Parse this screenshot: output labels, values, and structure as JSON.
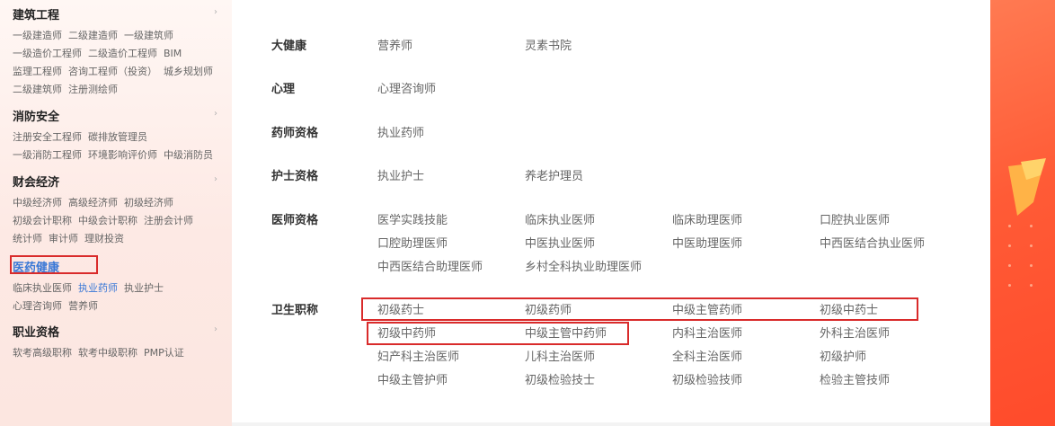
{
  "sidebar": {
    "categories": [
      {
        "title": "建筑工程",
        "rows": [
          [
            "一级建造师",
            "二级建造师",
            "一级建筑师"
          ],
          [
            "一级造价工程师",
            "二级造价工程师",
            "BIM"
          ],
          [
            "监理工程师",
            "咨询工程师（投资）",
            "城乡规划师"
          ],
          [
            "二级建筑师",
            "注册测绘师"
          ]
        ]
      },
      {
        "title": "消防安全",
        "rows": [
          [
            "注册安全工程师",
            "碳排放管理员"
          ],
          [
            "一级消防工程师",
            "环境影响评价师",
            "中级消防员"
          ]
        ]
      },
      {
        "title": "财会经济",
        "rows": [
          [
            "中级经济师",
            "高级经济师",
            "初级经济师"
          ],
          [
            "初级会计职称",
            "中级会计职称",
            "注册会计师"
          ],
          [
            "统计师",
            "审计师",
            "理财投资"
          ]
        ]
      },
      {
        "title": "医药健康",
        "rows": [
          [
            "临床执业医师",
            "执业药师",
            "执业护士"
          ],
          [
            "心理咨询师",
            "营养师"
          ]
        ]
      },
      {
        "title": "职业资格",
        "rows": [
          [
            "软考高级职称",
            "软考中级职称",
            "PMP认证"
          ]
        ]
      }
    ],
    "arrow_glyph": "›",
    "accent_color": "#3a78d6"
  },
  "main": {
    "sections": [
      {
        "title": "大健康",
        "items": [
          "营养师",
          "灵素书院"
        ]
      },
      {
        "title": "心理",
        "items": [
          "心理咨询师"
        ]
      },
      {
        "title": "药师资格",
        "items": [
          "执业药师"
        ]
      },
      {
        "title": "护士资格",
        "items": [
          "执业护士",
          "养老护理员"
        ]
      },
      {
        "title": "医师资格",
        "items": [
          "医学实践技能",
          "临床执业医师",
          "临床助理医师",
          "口腔执业医师",
          "口腔助理医师",
          "中医执业医师",
          "中医助理医师",
          "中西医结合执业医师",
          "中西医结合助理医师",
          "乡村全科执业助理医师"
        ]
      },
      {
        "title": "卫生职称",
        "items": [
          "初级药士",
          "初级药师",
          "中级主管药师",
          "初级中药士",
          "初级中药师",
          "中级主管中药师",
          "内科主治医师",
          "外科主治医师",
          "妇产科主治医师",
          "儿科主治医师",
          "全科主治医师",
          "初级护师",
          "中级主管护师",
          "初级检验技士",
          "初级检验技师",
          "检验主管技师"
        ]
      }
    ]
  },
  "colors": {
    "highlight_box": "#d92b2b",
    "banner": "#ff5b36"
  }
}
